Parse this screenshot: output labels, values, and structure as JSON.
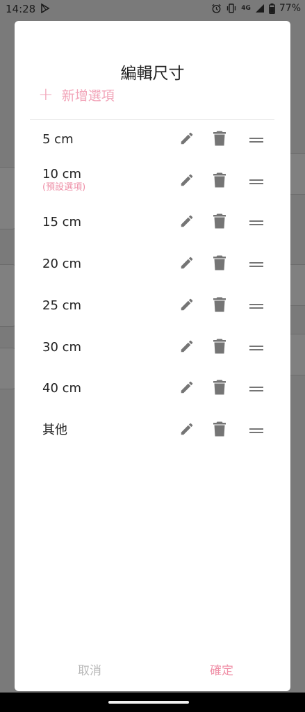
{
  "status_bar": {
    "time": "14:28",
    "network": "4G",
    "battery": "77%"
  },
  "dialog": {
    "title": "編輯尺寸",
    "add_option_label": "新增選項",
    "add_icon": "plus-icon",
    "items": [
      {
        "label": "5 cm",
        "sub": ""
      },
      {
        "label": "10 cm",
        "sub": "(預設選項)"
      },
      {
        "label": "15 cm",
        "sub": ""
      },
      {
        "label": "20 cm",
        "sub": ""
      },
      {
        "label": "25 cm",
        "sub": ""
      },
      {
        "label": "30 cm",
        "sub": ""
      },
      {
        "label": "40 cm",
        "sub": ""
      },
      {
        "label": "其他",
        "sub": ""
      }
    ],
    "row_icons": [
      "pencil-icon",
      "trash-icon",
      "drag-handle-icon"
    ],
    "cancel_label": "取消",
    "confirm_label": "確定"
  },
  "colors": {
    "accent": "#f092a9",
    "icon": "#757575",
    "scrim": "#7a7a7a"
  }
}
